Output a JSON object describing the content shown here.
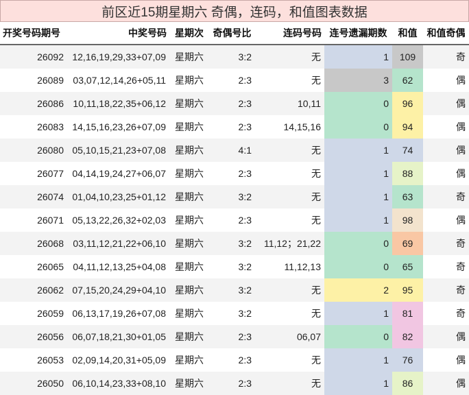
{
  "title": "前区近15期星期六 奇偶，连码，和值图表数据",
  "headers": [
    "开奖号码期号",
    "中奖号码",
    "星期次",
    "奇偶号比",
    "连码号码",
    "连号遗漏期数",
    "和值",
    "和值奇偶"
  ],
  "rows": [
    {
      "issue": "26092",
      "numbers": "12,16,19,29,33+07,09",
      "weekday": "星期六",
      "ratio": "3:2",
      "consec": "无",
      "gap": "1",
      "sum": "109",
      "parity": "奇",
      "gap_color": "#cfd8e8",
      "sum_color": "#c8c8c8"
    },
    {
      "issue": "26089",
      "numbers": "03,07,12,14,26+05,11",
      "weekday": "星期六",
      "ratio": "2:3",
      "consec": "无",
      "gap": "3",
      "sum": "62",
      "parity": "偶",
      "gap_color": "#c8c8c8",
      "sum_color": "#b5e4cc"
    },
    {
      "issue": "26086",
      "numbers": "10,11,18,22,35+06,12",
      "weekday": "星期六",
      "ratio": "2:3",
      "consec": "10,11",
      "gap": "0",
      "sum": "96",
      "parity": "偶",
      "gap_color": "#b5e4cc",
      "sum_color": "#fdf1a6"
    },
    {
      "issue": "26083",
      "numbers": "14,15,16,23,26+07,09",
      "weekday": "星期六",
      "ratio": "2:3",
      "consec": "14,15,16",
      "gap": "0",
      "sum": "94",
      "parity": "偶",
      "gap_color": "#b5e4cc",
      "sum_color": "#fdf1a6"
    },
    {
      "issue": "26080",
      "numbers": "05,10,15,21,23+07,08",
      "weekday": "星期六",
      "ratio": "4:1",
      "consec": "无",
      "gap": "1",
      "sum": "74",
      "parity": "偶",
      "gap_color": "#cfd8e8",
      "sum_color": "#cfd8e8"
    },
    {
      "issue": "26077",
      "numbers": "04,14,19,24,27+06,07",
      "weekday": "星期六",
      "ratio": "2:3",
      "consec": "无",
      "gap": "1",
      "sum": "88",
      "parity": "偶",
      "gap_color": "#cfd8e8",
      "sum_color": "#e6f3c8"
    },
    {
      "issue": "26074",
      "numbers": "01,04,10,23,25+01,12",
      "weekday": "星期六",
      "ratio": "3:2",
      "consec": "无",
      "gap": "1",
      "sum": "63",
      "parity": "奇",
      "gap_color": "#cfd8e8",
      "sum_color": "#b5e4cc"
    },
    {
      "issue": "26071",
      "numbers": "05,13,22,26,32+02,03",
      "weekday": "星期六",
      "ratio": "2:3",
      "consec": "无",
      "gap": "1",
      "sum": "98",
      "parity": "偶",
      "gap_color": "#cfd8e8",
      "sum_color": "#f3e3cd"
    },
    {
      "issue": "26068",
      "numbers": "03,11,12,21,22+06,10",
      "weekday": "星期六",
      "ratio": "3:2",
      "consec": "11,12；21,22",
      "gap": "0",
      "sum": "69",
      "parity": "奇",
      "gap_color": "#b5e4cc",
      "sum_color": "#f9c7a4"
    },
    {
      "issue": "26065",
      "numbers": "04,11,12,13,25+04,08",
      "weekday": "星期六",
      "ratio": "3:2",
      "consec": "11,12,13",
      "gap": "0",
      "sum": "65",
      "parity": "奇",
      "gap_color": "#b5e4cc",
      "sum_color": "#b5e4cc"
    },
    {
      "issue": "26062",
      "numbers": "07,15,20,24,29+04,10",
      "weekday": "星期六",
      "ratio": "3:2",
      "consec": "无",
      "gap": "2",
      "sum": "95",
      "parity": "奇",
      "gap_color": "#fdf1a6",
      "sum_color": "#fdf1a6"
    },
    {
      "issue": "26059",
      "numbers": "06,13,17,19,26+07,08",
      "weekday": "星期六",
      "ratio": "3:2",
      "consec": "无",
      "gap": "1",
      "sum": "81",
      "parity": "奇",
      "gap_color": "#cfd8e8",
      "sum_color": "#f1c6e2"
    },
    {
      "issue": "26056",
      "numbers": "06,07,18,21,30+01,05",
      "weekday": "星期六",
      "ratio": "2:3",
      "consec": "06,07",
      "gap": "0",
      "sum": "82",
      "parity": "偶",
      "gap_color": "#b5e4cc",
      "sum_color": "#f1c6e2"
    },
    {
      "issue": "26053",
      "numbers": "02,09,14,20,31+05,09",
      "weekday": "星期六",
      "ratio": "2:3",
      "consec": "无",
      "gap": "1",
      "sum": "76",
      "parity": "偶",
      "gap_color": "#cfd8e8",
      "sum_color": "#cfd8e8"
    },
    {
      "issue": "26050",
      "numbers": "06,10,14,23,33+08,10",
      "weekday": "星期六",
      "ratio": "2:3",
      "consec": "无",
      "gap": "1",
      "sum": "86",
      "parity": "偶",
      "gap_color": "#cfd8e8",
      "sum_color": "#e6f3c8"
    }
  ]
}
